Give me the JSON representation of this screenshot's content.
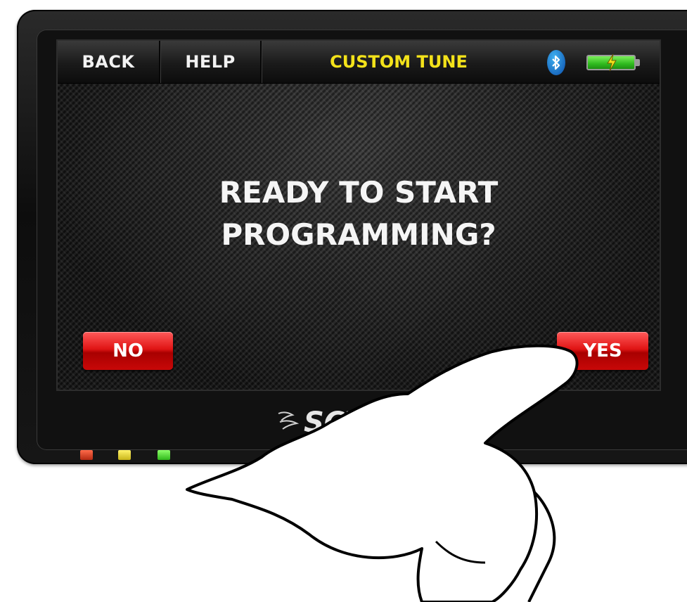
{
  "topbar": {
    "back_label": "BACK",
    "help_label": "HELP",
    "title": "CUSTOM TUNE",
    "title_color": "#f3e21a",
    "bluetooth_icon": "bluetooth-icon",
    "battery_icon": "battery-charging-icon"
  },
  "dialog": {
    "line1": "READY TO START",
    "line2": "PROGRAMMING?"
  },
  "buttons": {
    "no_label": "NO",
    "yes_label": "YES",
    "button_color": "#e01414"
  },
  "device": {
    "brand_logo": "SCT",
    "status_leds": [
      "red",
      "yellow",
      "green"
    ]
  }
}
